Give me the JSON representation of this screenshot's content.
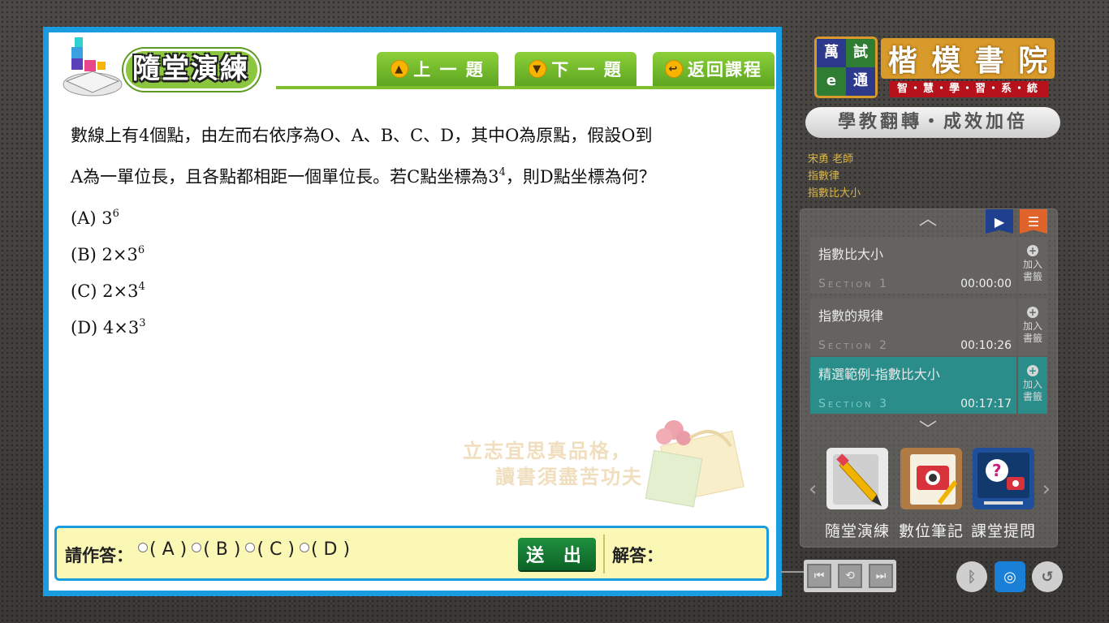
{
  "exercise": {
    "title": "隨堂演練",
    "nav": {
      "prev_label": "上 一 題",
      "next_label": "下 一 題",
      "back_label": "返回課程"
    },
    "question": {
      "line1": "數線上有4個點，由左而右依序為O、A、B、C、D，其中O為原點，假設O到",
      "line2_pre": "A為一單位長，且各點都相距一個單位長。若C點坐標為3",
      "line2_exp": "4",
      "line2_post": "，則D點坐標為何？"
    },
    "options": [
      {
        "prefix": "(A) 3",
        "exp": "6"
      },
      {
        "prefix": "(B) 2×3",
        "exp": "6"
      },
      {
        "prefix": "(C) 2×3",
        "exp": "4"
      },
      {
        "prefix": "(D) 4×3",
        "exp": "3"
      }
    ],
    "watermark": {
      "line1": "立志宜思真品格，",
      "line2": "讀書須盡苦功夫"
    },
    "answer": {
      "prompt": "請作答：",
      "choices": [
        "( A )",
        "( B )",
        "( C )",
        "( D )"
      ],
      "submit_label": "送 出",
      "solution_label": "解答："
    }
  },
  "brand": {
    "seal_chars": [
      "萬",
      "試",
      "e",
      "通"
    ],
    "name_chars": [
      "楷",
      "模",
      "書",
      "院"
    ],
    "tagline": "智・慧・學・習・系・統",
    "slogan": "學教翻轉・成效加倍"
  },
  "course_meta": {
    "teacher": "宋勇 老師",
    "chapter": "指數律",
    "lesson": "指數比大小"
  },
  "playlist": {
    "sections": [
      {
        "title": "指數比大小",
        "label": "Section 1",
        "time": "00:00:00",
        "add": "加入書籤",
        "active": false
      },
      {
        "title": "指數的規律",
        "label": "Section 2",
        "time": "00:10:26",
        "add": "加入書籤",
        "active": false
      },
      {
        "title": "精選範例-指數比大小",
        "label": "Section 3",
        "time": "00:17:17",
        "add": "加入書籤",
        "active": true
      }
    ],
    "tools": [
      {
        "label": "隨堂演練"
      },
      {
        "label": "數位筆記"
      },
      {
        "label": "課堂提問"
      }
    ]
  },
  "colors": {
    "panel_border": "#1a9de0",
    "header_green": "#8cc63f",
    "active_section": "#2a8d8a",
    "submit_green": "#1f8f3f",
    "answer_bg": "#fbf7b5"
  }
}
